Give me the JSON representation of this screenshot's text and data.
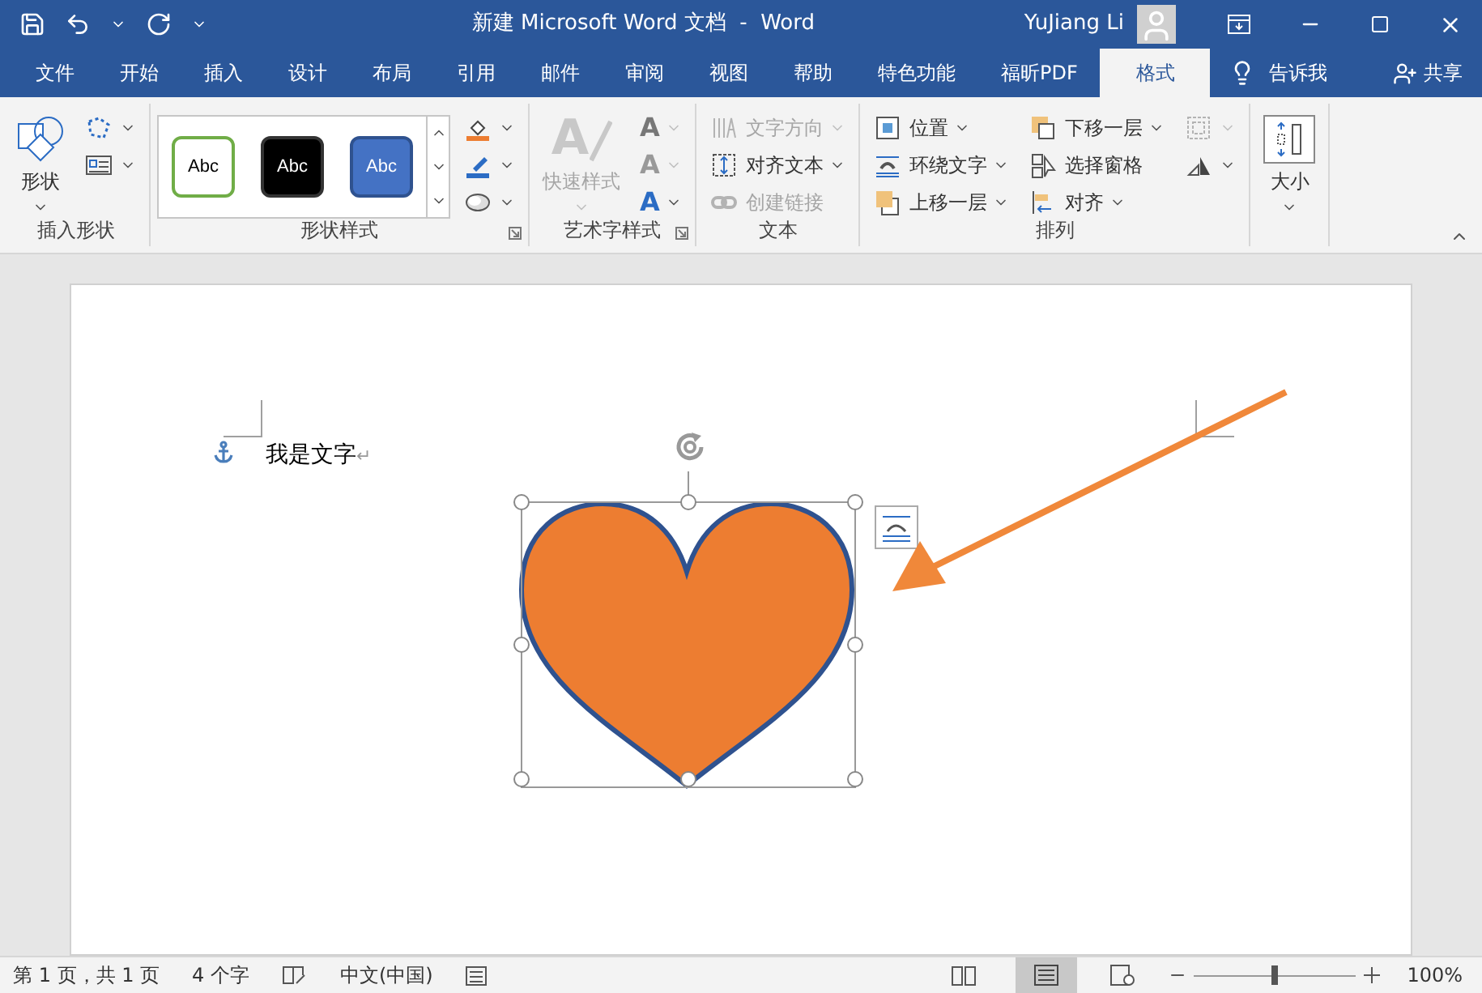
{
  "title_bar": {
    "title": "新建 Microsoft Word 文档  -  Word",
    "user": "YuJiang Li"
  },
  "tabs": [
    {
      "label": "文件",
      "selected": false
    },
    {
      "label": "开始",
      "selected": false
    },
    {
      "label": "插入",
      "selected": false
    },
    {
      "label": "设计",
      "selected": false
    },
    {
      "label": "布局",
      "selected": false
    },
    {
      "label": "引用",
      "selected": false
    },
    {
      "label": "邮件",
      "selected": false
    },
    {
      "label": "审阅",
      "selected": false
    },
    {
      "label": "视图",
      "selected": false
    },
    {
      "label": "帮助",
      "selected": false
    },
    {
      "label": "特色功能",
      "selected": false
    },
    {
      "label": "福昕PDF",
      "selected": false
    },
    {
      "label": "格式",
      "selected": true
    }
  ],
  "tell_me": "告诉我",
  "share": "共享",
  "ribbon": [
    {
      "label": "插入形状",
      "launcher": false,
      "columns": [
        [
          {
            "kind": "large",
            "label": "形状",
            "disabled": false,
            "caret": true
          }
        ],
        [
          {
            "kind": "icon",
            "disabled": false,
            "caret": true
          },
          {
            "kind": "icon",
            "disabled": false,
            "caret": true
          }
        ]
      ]
    },
    {
      "label": "形状样式",
      "launcher": true,
      "gallery": [
        {
          "label": "Abc",
          "kind": "outline"
        },
        {
          "label": "Abc",
          "kind": "dark"
        },
        {
          "label": "Abc",
          "kind": "filled"
        }
      ],
      "columns": [
        [
          {
            "kind": "icon",
            "disabled": false,
            "caret": true
          },
          {
            "kind": "icon",
            "disabled": false,
            "caret": true
          },
          {
            "kind": "icon",
            "disabled": false,
            "caret": true
          }
        ]
      ]
    },
    {
      "label": "艺术字样式",
      "launcher": true,
      "columns": [
        [
          {
            "kind": "large",
            "label": "快速样式",
            "glyph": "A",
            "disabled": true,
            "caret": true
          }
        ],
        [
          {
            "kind": "icon",
            "glyph": "A",
            "disabled": true,
            "caret": true
          },
          {
            "kind": "icon",
            "glyph": "A",
            "disabled": true,
            "caret": true
          },
          {
            "kind": "icon",
            "glyph": "A",
            "disabled": false,
            "caret": true
          }
        ]
      ]
    },
    {
      "label": "文本",
      "launcher": false,
      "columns": [
        [
          {
            "kind": "small",
            "label": "文字方向",
            "disabled": true,
            "caret": true
          },
          {
            "kind": "small",
            "label": "对齐文本",
            "disabled": false,
            "caret": true
          },
          {
            "kind": "small",
            "label": "创建链接",
            "disabled": true,
            "caret": false
          }
        ]
      ]
    },
    {
      "label": "排列",
      "launcher": false,
      "columns": [
        [
          {
            "kind": "small",
            "label": "位置",
            "disabled": false,
            "caret": true
          },
          {
            "kind": "small",
            "label": "环绕文字",
            "disabled": false,
            "caret": true
          },
          {
            "kind": "small",
            "label": "上移一层",
            "disabled": false,
            "caret": true
          }
        ],
        [
          {
            "kind": "small",
            "label": "下移一层",
            "disabled": false,
            "caret": true
          },
          {
            "kind": "small",
            "label": "选择窗格",
            "disabled": false,
            "caret": false
          },
          {
            "kind": "small",
            "label": "对齐",
            "disabled": false,
            "caret": true
          }
        ],
        [
          {
            "kind": "icon",
            "disabled": true,
            "caret": true
          },
          {
            "kind": "icon",
            "disabled": false,
            "caret": true
          }
        ]
      ]
    },
    {
      "columns": [
        [
          {
            "kind": "large",
            "label": "大小",
            "disabled": false,
            "caret": true
          }
        ]
      ]
    }
  ],
  "document": {
    "text": "我是文字",
    "paragraph_mark": "↵"
  },
  "status_bar": {
    "page": "第 1 页，共 1 页",
    "words": "4 个字",
    "language": "中文(中国)",
    "zoom": {
      "level": 0.5,
      "percent": "100%"
    }
  }
}
